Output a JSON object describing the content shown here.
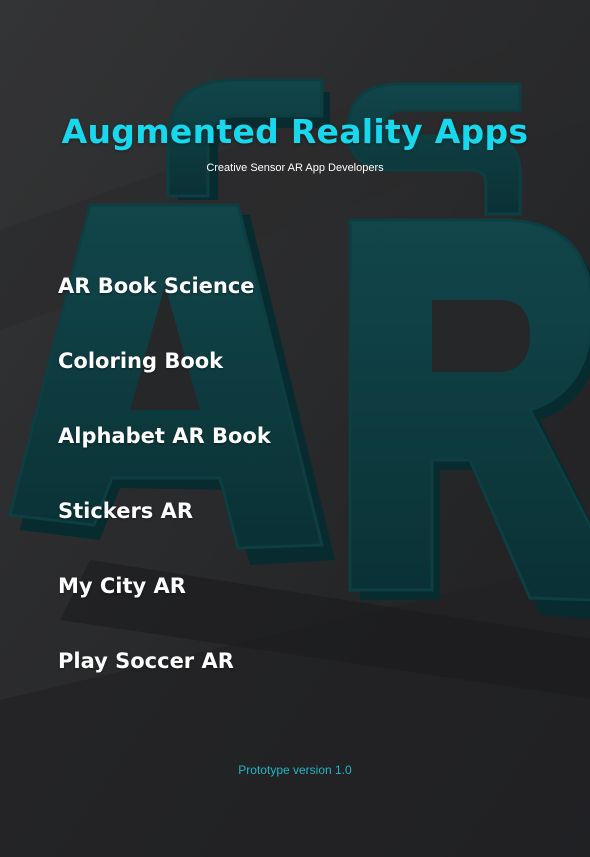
{
  "header": {
    "title": "Augmented Reality Apps",
    "subtitle": "Creative Sensor AR App Developers"
  },
  "background": {
    "logo_text": "CS AR",
    "logo_color": "#0f4247"
  },
  "menu": {
    "items": [
      {
        "label": "AR Book Science"
      },
      {
        "label": "Coloring Book"
      },
      {
        "label": "Alphabet AR Book"
      },
      {
        "label": "Stickers AR"
      },
      {
        "label": "My City AR"
      },
      {
        "label": "Play Soccer AR"
      }
    ]
  },
  "footer": {
    "version": "Prototype version 1.0"
  },
  "colors": {
    "accent": "#18d8ee",
    "background": "#2b2c2e",
    "text": "#ffffff"
  }
}
